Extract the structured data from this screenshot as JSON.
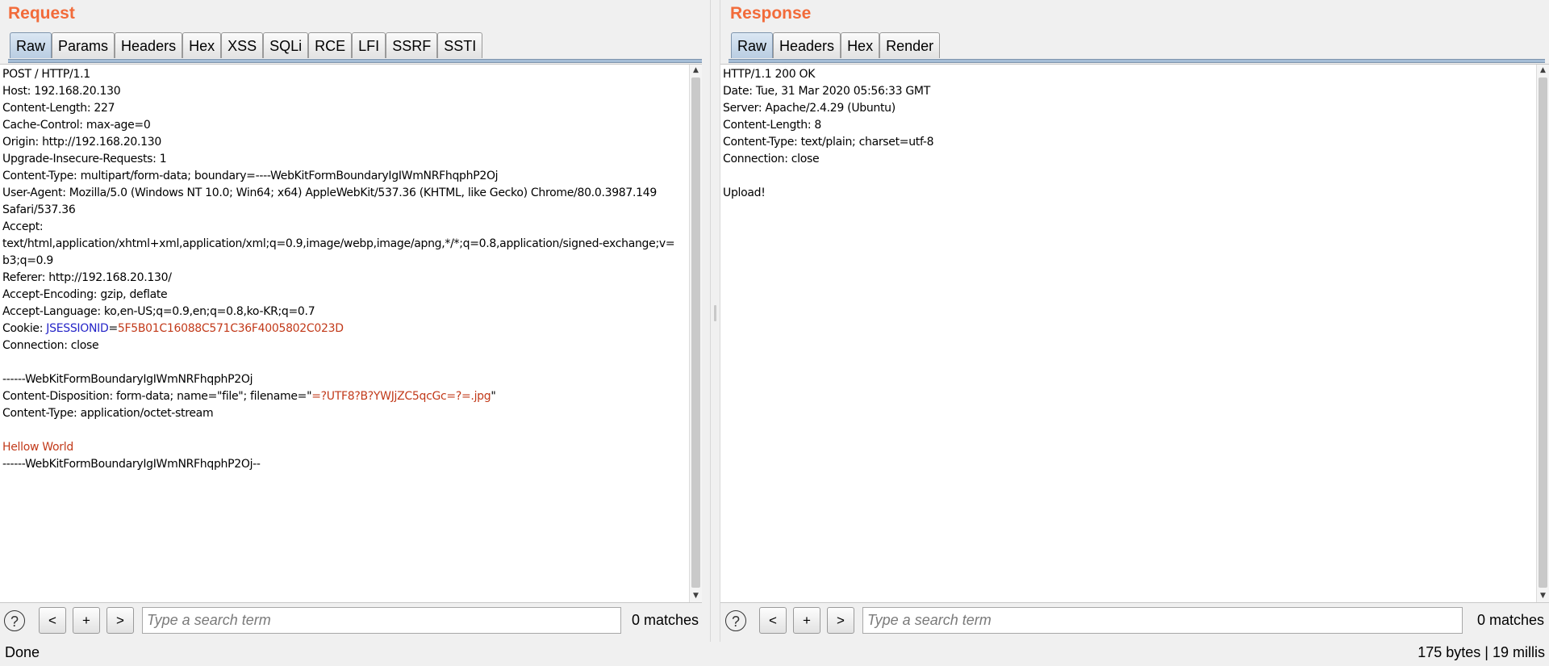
{
  "request": {
    "title": "Request",
    "tabs": [
      "Raw",
      "Params",
      "Headers",
      "Hex",
      "XSS",
      "SQLi",
      "RCE",
      "LFI",
      "SSRF",
      "SSTI"
    ],
    "active_tab": "Raw",
    "lines": [
      {
        "text": "POST / HTTP/1.1"
      },
      {
        "text": "Host: 192.168.20.130"
      },
      {
        "text": "Content-Length: 227"
      },
      {
        "text": "Cache-Control: max-age=0"
      },
      {
        "text": "Origin: http://192.168.20.130"
      },
      {
        "text": "Upgrade-Insecure-Requests: 1"
      },
      {
        "text": "Content-Type: multipart/form-data; boundary=----WebKitFormBoundaryIgIWmNRFhqphP2Oj"
      },
      {
        "text": "User-Agent: Mozilla/5.0 (Windows NT 10.0; Win64; x64) AppleWebKit/537.36 (KHTML, like Gecko) Chrome/80.0.3987.149"
      },
      {
        "text": "Safari/537.36"
      },
      {
        "text": "Accept:"
      },
      {
        "text": "text/html,application/xhtml+xml,application/xml;q=0.9,image/webp,image/apng,*/*;q=0.8,application/signed-exchange;v="
      },
      {
        "text": "b3;q=0.9"
      },
      {
        "text": "Referer: http://192.168.20.130/"
      },
      {
        "text": "Accept-Encoding: gzip, deflate"
      },
      {
        "text": "Accept-Language: ko,en-US;q=0.9,en;q=0.8,ko-KR;q=0.7"
      },
      {
        "parts": [
          {
            "text": "Cookie: ",
            "style": ""
          },
          {
            "text": "JSESSIONID",
            "style": "hname"
          },
          {
            "text": "=",
            "style": ""
          },
          {
            "text": "5F5B01C16088C571C36F4005802C023D",
            "style": "hval"
          }
        ]
      },
      {
        "text": "Connection: close"
      },
      {
        "text": ""
      },
      {
        "text": "------WebKitFormBoundaryIgIWmNRFhqphP2Oj"
      },
      {
        "parts": [
          {
            "text": "Content-Disposition: form-data; name=\"file\"; filename=\"",
            "style": ""
          },
          {
            "text": "=?UTF8?B?YWJjZC5qcGc=?=.jpg",
            "style": "hval"
          },
          {
            "text": "\"",
            "style": ""
          }
        ]
      },
      {
        "text": "Content-Type: application/octet-stream"
      },
      {
        "text": ""
      },
      {
        "text": "Hellow World",
        "style": "body-text"
      },
      {
        "text": "------WebKitFormBoundaryIgIWmNRFhqphP2Oj--"
      }
    ],
    "search": {
      "placeholder": "Type a search term",
      "value": "",
      "matches": "0 matches"
    },
    "nav": {
      "prev": "<",
      "add": "+",
      "next": ">",
      "help": "?"
    }
  },
  "response": {
    "title": "Response",
    "tabs": [
      "Raw",
      "Headers",
      "Hex",
      "Render"
    ],
    "active_tab": "Raw",
    "lines": [
      {
        "text": "HTTP/1.1 200 OK"
      },
      {
        "text": "Date: Tue, 31 Mar 2020 05:56:33 GMT"
      },
      {
        "text": "Server: Apache/2.4.29 (Ubuntu)"
      },
      {
        "text": "Content-Length: 8"
      },
      {
        "text": "Content-Type: text/plain; charset=utf-8"
      },
      {
        "text": "Connection: close"
      },
      {
        "text": ""
      },
      {
        "text": "Upload!"
      }
    ],
    "search": {
      "placeholder": "Type a search term",
      "value": "",
      "matches": "0 matches"
    },
    "nav": {
      "prev": "<",
      "add": "+",
      "next": ">",
      "help": "?"
    }
  },
  "status": {
    "left": "Done",
    "right": "175 bytes | 19 millis"
  },
  "colors": {
    "title": "#f26b3a",
    "header_name": "#2525c8",
    "header_value": "#c23a1a"
  }
}
